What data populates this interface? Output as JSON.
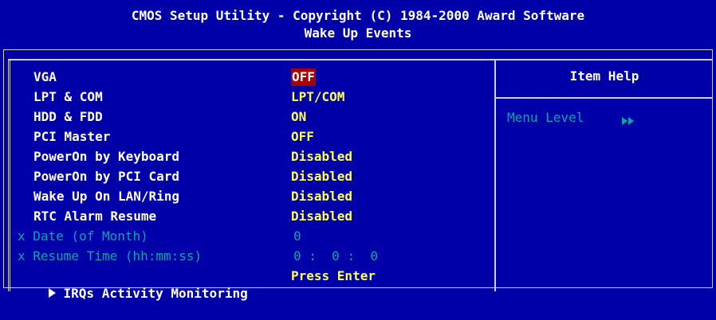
{
  "header": {
    "title": "CMOS Setup Utility - Copyright (C) 1984-2000 Award Software",
    "subtitle": "Wake Up Events"
  },
  "items": [
    {
      "label": "VGA",
      "value": "OFF",
      "state": "selected"
    },
    {
      "label": "LPT & COM",
      "value": "LPT/COM",
      "state": "normal"
    },
    {
      "label": "HDD & FDD",
      "value": "ON",
      "state": "normal"
    },
    {
      "label": "PCI Master",
      "value": "OFF",
      "state": "normal"
    },
    {
      "label": "PowerOn by Keyboard",
      "value": "Disabled",
      "state": "normal"
    },
    {
      "label": "PowerOn by PCI Card",
      "value": "Disabled",
      "state": "normal"
    },
    {
      "label": "Wake Up On LAN/Ring",
      "value": "Disabled",
      "state": "normal"
    },
    {
      "label": "RTC Alarm Resume",
      "value": "Disabled",
      "state": "normal"
    },
    {
      "label": "x Date (of Month)",
      "value": "0",
      "state": "disabled"
    },
    {
      "label": "x Resume Time (hh:mm:ss)",
      "value": "0 :  0 :  0",
      "state": "disabled"
    },
    {
      "label": "IRQs Activity Monitoring",
      "value": "Press Enter",
      "state": "submenu"
    }
  ],
  "help": {
    "title": "Item Help",
    "menu_level_label": "Menu Level"
  },
  "colors": {
    "background": "#0000a8",
    "label": "#ffffff",
    "value": "#ffff55",
    "disabled": "#00a8a8",
    "selected_bg": "#a80000"
  }
}
